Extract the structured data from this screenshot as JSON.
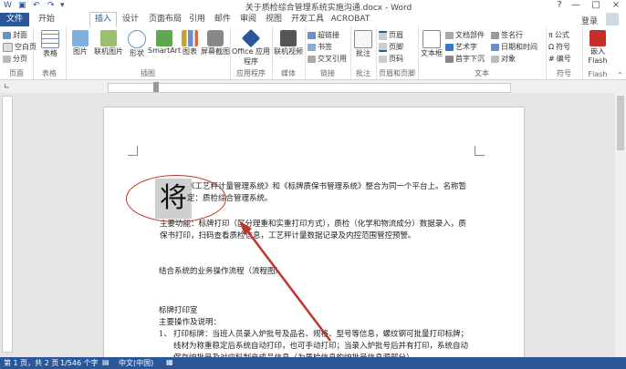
{
  "window": {
    "title": "关于质检综合管理系统实施沟通.docx - Word",
    "help": "?",
    "minimize": "—",
    "restore": "□",
    "close": "×"
  },
  "tabs": {
    "file": "文件",
    "items": [
      "开始",
      "插入",
      "设计",
      "页面布局",
      "引用",
      "邮件",
      "审阅",
      "视图",
      "开发工具",
      "ACROBAT"
    ],
    "active": "插入",
    "login": "登录"
  },
  "ribbon": {
    "pages": {
      "label": "页面",
      "items": [
        "封面",
        "空白页",
        "分页"
      ]
    },
    "tables": {
      "label": "表格",
      "items": [
        "表格"
      ]
    },
    "illustrations": {
      "label": "插图",
      "items": [
        "图片",
        "联机图片",
        "形状",
        "SmartArt",
        "图表",
        "屏幕截图"
      ]
    },
    "apps": {
      "label": "应用程序",
      "items": [
        "Office 应用程序"
      ]
    },
    "media": {
      "label": "媒体",
      "items": [
        "联机视频"
      ]
    },
    "links": {
      "label": "链接",
      "items": [
        "超链接",
        "书签",
        "交叉引用"
      ]
    },
    "comments": {
      "label": "批注",
      "items": [
        "批注"
      ]
    },
    "header_footer": {
      "label": "页眉和页脚",
      "items": [
        "页眉",
        "页脚",
        "页码"
      ]
    },
    "text": {
      "label": "文本",
      "items": [
        "文本框",
        "文档部件",
        "艺术字",
        "首字下沉",
        "签名行",
        "日期和时间",
        "对象"
      ]
    },
    "symbols": {
      "label": "符号",
      "items": [
        "公式",
        "符号",
        "编号"
      ]
    },
    "flash": {
      "label": "Flash",
      "items": [
        "嵌入 Flash"
      ]
    }
  },
  "document": {
    "big_char": "将",
    "lines": [
      "《工艺秤计量管理系统》和《标牌质保书管理系统》整合为同一个平台上。名称暂",
      "定：质检综合管理系统。",
      "主要功能：标牌打印（区分理重和实重打印方式），质检（化学和物流成分）数据录入，质",
      "保书打印，扫码查看质检信息，工艺秤计量数据记录及内控范围管控预警。",
      "结合系统的业务操作流程（流程图）",
      "标牌打印室",
      "主要操作及说明：",
      "打印标牌：当班人员录入炉批号及品名、规格、型号等信息，螺纹钢可批量打印标牌；",
      "线材为称重稳定后系统自动打印，也可手动打印；当录入炉批号后并有打印，系统自动",
      "保存炉批号及对应料制产成品信息（为质检信息的炉批号信息源部分）"
    ],
    "list_number": "1、",
    "link_text": "扫码查看"
  },
  "status": {
    "page": "第 1 页，共 2 页",
    "words": "1/546 个字",
    "lang": "中文(中国)"
  },
  "colors": {
    "accent": "#2b579a",
    "annotation": "#c0342b"
  }
}
